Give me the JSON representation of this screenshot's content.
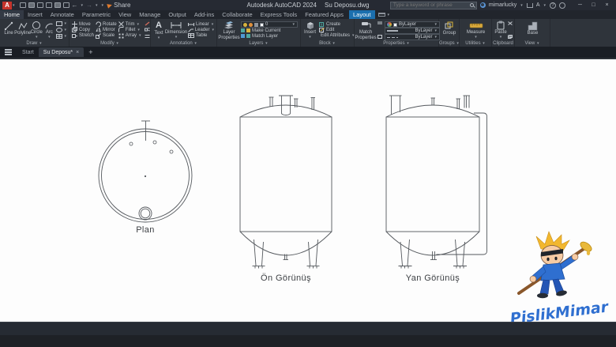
{
  "titlebar": {
    "app_name": "Autodesk AutoCAD 2024",
    "doc_name": "Su Deposu.dwg",
    "search_placeholder": "Type a keyword or phrase",
    "username": "mimarlucky",
    "share_label": "Share",
    "logo_letter": "A",
    "autodesk_letter": "A"
  },
  "glyphs": {
    "caret": "▾",
    "close": "×",
    "plus": "+",
    "minimize": "─",
    "maximize": "□",
    "undo": "←",
    "redo": "→",
    "help": "?",
    "slideout": "≡"
  },
  "ribbon": {
    "tabs": [
      "Home",
      "Insert",
      "Annotate",
      "Parametric",
      "View",
      "Manage",
      "Output",
      "Add-ins",
      "Collaborate",
      "Express Tools",
      "Featured Apps",
      "Layout"
    ],
    "draw": {
      "label": "Draw",
      "line": "Line",
      "polyline": "Polyline",
      "circle": "Circle",
      "arc": "Arc"
    },
    "modify": {
      "label": "Modify",
      "move": "Move",
      "copy": "Copy",
      "stretch": "Stretch",
      "rotate": "Rotate",
      "mirror": "Mirror",
      "scale": "Scale",
      "trim": "Trim",
      "fillet": "Fillet",
      "array": "Array"
    },
    "annotation": {
      "label": "Annotation",
      "text": "Text",
      "dimension": "Dimension",
      "linear": "Linear",
      "leader": "Leader",
      "table": "Table"
    },
    "layers": {
      "label": "Layers",
      "layer_properties": "Layer Properties",
      "current_layer": "0",
      "make_current": "Make Current",
      "match_layer": "Match Layer"
    },
    "block": {
      "label": "Block",
      "insert": "Insert",
      "create": "Create",
      "edit": "Edit",
      "edit_attributes": "Edit Attributes"
    },
    "properties": {
      "label": "Properties",
      "match_properties": "Match Properties",
      "color_value": "ByLayer",
      "lineweight_value": "ByLayer",
      "linetype_value": "ByLayer"
    },
    "groups": {
      "label": "Groups",
      "group": "Group"
    },
    "utilities": {
      "label": "Utilities",
      "measure": "Measure"
    },
    "clipboard": {
      "label": "Clipboard",
      "paste": "Paste"
    },
    "view": {
      "label": "View",
      "base": "Base"
    }
  },
  "file_tabs": {
    "start": "Start",
    "document": "Su Deposu*"
  },
  "drawing": {
    "plan_label": "Plan",
    "front_label": "Ön Görünüş",
    "side_label": "Yan Görünüş",
    "line_color": "#54585d"
  },
  "watermark": {
    "text": "PislikMimar",
    "color": "#2f6fd0"
  },
  "colors": {
    "titlebar": "#262a33",
    "ribbon_bg": "#2f343b",
    "layout_tab_blue": "#1b6fae",
    "canvas": "#fdfdfd",
    "logo_red": "#c5332b"
  }
}
